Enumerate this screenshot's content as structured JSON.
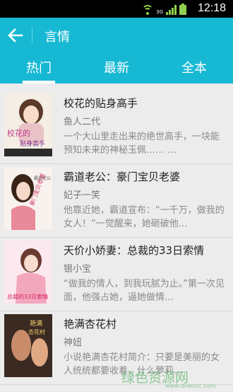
{
  "status_bar": {
    "time": "12:18",
    "network_label": "3G",
    "wifi_icon": "wifi-icon",
    "signal_icon": "signal-icon",
    "battery_icon": "battery-icon",
    "accent": "#8fd14f"
  },
  "header": {
    "title": "言情",
    "back_icon": "arrow-left-icon",
    "background": "#17b8d3"
  },
  "tabs": [
    {
      "label": "热门",
      "selected": true
    },
    {
      "label": "最新",
      "selected": false
    },
    {
      "label": "全本",
      "selected": false
    }
  ],
  "books": [
    {
      "title": "校花的贴身高手",
      "author": "鱼人二代",
      "description": "一个大山里走出来的绝世高手，一块能预知未来的神秘玉佩……  …",
      "cover_text": [
        "校花的",
        "贴身高手"
      ]
    },
    {
      "title": "霸道老公：豪门宝贝老婆",
      "author": "妃子一笑",
      "description": "他靠近她，霸道宣布：“一千万，做我的女人！”一觉醒来，她砸破他…",
      "cover_text": [
        "霸道老公",
        "豪门宝贝老婆"
      ]
    },
    {
      "title": "天价小娇妻：总裁的33日索情",
      "author": "银小宝",
      "description": "“做我的情人，到我玩腻为止。”第一次见面，他强占她，逼她做情…",
      "cover_text": [
        "总裁的33日索情"
      ]
    },
    {
      "title": "艳满杏花村",
      "author": "神妞",
      "description": "小说艳满杏花村简介：只要是美丽的女人统统都要收着，什么萝莉…",
      "cover_text": [
        "艳满",
        "杏花村"
      ]
    }
  ],
  "watermark": {
    "text": "绿色资源网",
    "url": "www.downcc.com"
  }
}
